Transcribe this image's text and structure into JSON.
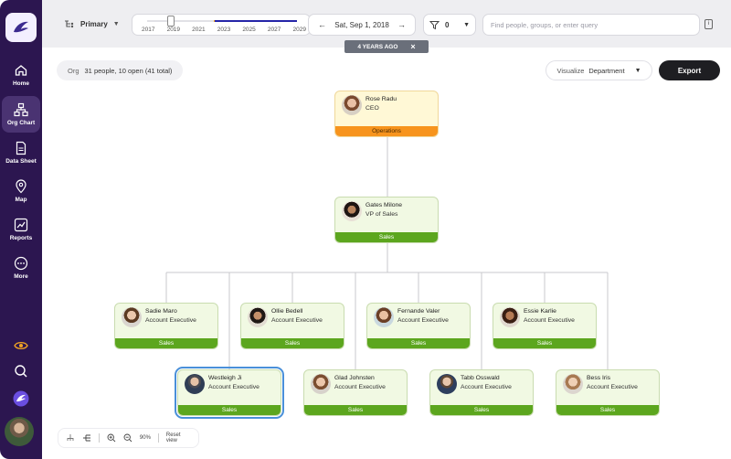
{
  "sidebar": {
    "items": [
      {
        "label": "Home",
        "icon": "home-icon"
      },
      {
        "label": "Org Chart",
        "icon": "org-chart-icon",
        "active": true
      },
      {
        "label": "Data Sheet",
        "icon": "document-icon"
      },
      {
        "label": "Map",
        "icon": "map-pin-icon"
      },
      {
        "label": "Reports",
        "icon": "reports-icon"
      },
      {
        "label": "More",
        "icon": "more-icon"
      }
    ]
  },
  "topbar": {
    "view_label": "Primary",
    "timeline_years": [
      "2017",
      "2019",
      "2021",
      "2023",
      "2025",
      "2027",
      "2029"
    ],
    "date": "Sat, Sep 1, 2018",
    "filter_count": "0",
    "search_placeholder": "Find people, groups, or enter query",
    "banner": "4 YEARS AGO",
    "banner_close": "×"
  },
  "canvas": {
    "org_label": "Org",
    "org_stats": "31 people, 10 open (41 total)",
    "visualize_label": "Visualize",
    "visualize_value": "Department",
    "export_label": "Export"
  },
  "people": [
    {
      "name": "Rose Radu",
      "title": "CEO",
      "dept": "Operations"
    },
    {
      "name": "Gates Milone",
      "title": "VP of Sales",
      "dept": "Sales"
    },
    {
      "name": "Sadie Maro",
      "title": "Account Executive",
      "dept": "Sales"
    },
    {
      "name": "Ollie Bedell",
      "title": "Account Executive",
      "dept": "Sales"
    },
    {
      "name": "Fernande Valer",
      "title": "Account Executive",
      "dept": "Sales"
    },
    {
      "name": "Essie Karlie",
      "title": "Account Executive",
      "dept": "Sales"
    },
    {
      "name": "Westleigh Ji",
      "title": "Account Executive",
      "dept": "Sales"
    },
    {
      "name": "Glad Johnsten",
      "title": "Account Executive",
      "dept": "Sales"
    },
    {
      "name": "Tabb Osswald",
      "title": "Account Executive",
      "dept": "Sales"
    },
    {
      "name": "Bess Iris",
      "title": "Account Executive",
      "dept": "Sales"
    }
  ],
  "toolbar": {
    "zoom": "90%",
    "reset_label": "Reset view"
  },
  "colors": {
    "sidebar": "#2c1650",
    "sales": "#5ca61e",
    "operations": "#f7941d",
    "selected": "#4a90d9"
  }
}
